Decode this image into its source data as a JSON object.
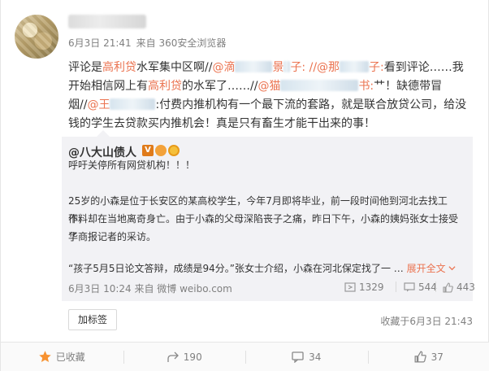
{
  "post": {
    "meta_date": "6月3日 21:41",
    "meta_source": "来自 360安全浏览器",
    "line1_a": "评论是",
    "line1_hl1": "高利贷",
    "line1_b": "水军集中区啊//",
    "line1_c": "@滴",
    "line1_d": "景",
    "line1_e": "子: //",
    "line1_f": "@那",
    "line1_g": "子:",
    "line1_h": "看到评论……我",
    "line2_a": "开始相信网上有",
    "line2_hl": "高利贷",
    "line2_b": "的水军了……//",
    "line2_c": "@猫",
    "line2_d": "书:",
    "line2_e": "艹！缺德带冒",
    "line3_a": "烟//",
    "line3_b": "@王",
    "line3_c": ":付费内推机构有一个最下流的套路，就是联合放贷公司，给没",
    "line4": "钱的学生去贷款买内推机会！真是只有畜生才能干出来的事！"
  },
  "repost": {
    "author": "@八大山债人",
    "badge_v": "V",
    "line1": "呼吁关停所有网贷机构！！！",
    "line2": "25岁的小森是位于长安区的某高校学生，今年7月即将毕业，前一段时间他到河北去找工作，",
    "line3": "不料却在当地离奇身亡。由于小森的父母深陷丧子之痛，昨日下午，小森的姨妈张女士接受了",
    "line4": "华商报记者的采访。",
    "line5": "“孩子5月5日论文答辩，成绩是94分。”张女士介绍，小森在河北保定找了一 …",
    "expand": "展开全文",
    "expand_icon": "chevron-down-icon",
    "footer": "6月3日 10:24 来自 微博 weibo.com",
    "repost_count": "1329",
    "comment_count": "544",
    "like_count": "443"
  },
  "tag_button": "加标签",
  "fav_time": "收藏于6月3日 21:43",
  "actions": {
    "favorite": "已收藏",
    "forward": "190",
    "comment": "34",
    "like": "37"
  },
  "colors": {
    "accent": "#eb7350",
    "muted": "#808080",
    "repost_bg": "#f2f2f5"
  }
}
